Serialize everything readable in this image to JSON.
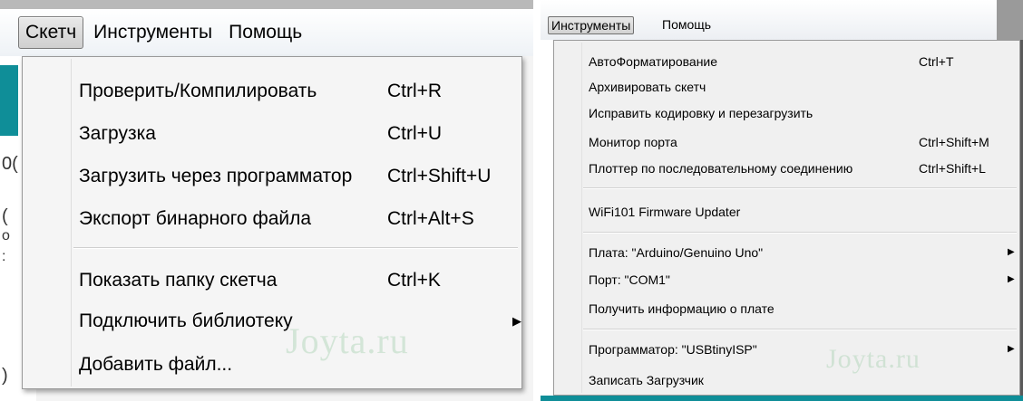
{
  "left": {
    "menubar": {
      "active": "Скетч",
      "items": [
        "Инструменты",
        "Помощь"
      ]
    },
    "menu": {
      "items": [
        {
          "label": "Проверить/Компилировать",
          "shortcut": "Ctrl+R"
        },
        {
          "label": "Загрузка",
          "shortcut": "Ctrl+U"
        },
        {
          "label": "Загрузить через программатор",
          "shortcut": "Ctrl+Shift+U"
        },
        {
          "label": "Экспорт бинарного файла",
          "shortcut": "Ctrl+Alt+S"
        },
        {
          "label": "Показать папку скетча",
          "shortcut": "Ctrl+K"
        },
        {
          "label": "Подключить библиотеку"
        },
        {
          "label": "Добавить файл..."
        }
      ]
    },
    "watermark": "Joyta.ru"
  },
  "right": {
    "menubar": {
      "active": "Инструменты",
      "items": [
        "Помощь"
      ]
    },
    "menu": {
      "items": [
        {
          "label": "АвтоФорматирование",
          "shortcut": "Ctrl+T"
        },
        {
          "label": "Архивировать скетч"
        },
        {
          "label": "Исправить кодировку и перезагрузить"
        },
        {
          "label": "Монитор порта",
          "shortcut": "Ctrl+Shift+M"
        },
        {
          "label": "Плоттер по последовательному соединению",
          "shortcut": "Ctrl+Shift+L"
        },
        {
          "label": "WiFi101 Firmware Updater"
        },
        {
          "label": "Плата: \"Arduino/Genuino Uno\""
        },
        {
          "label": "Порт: \"COM1\""
        },
        {
          "label": "Получить информацию о плате"
        },
        {
          "label": "Программатор: \"USBtinyISP\""
        },
        {
          "label": "Записать Загрузчик"
        }
      ]
    },
    "watermark": "Joyta.ru"
  },
  "icons": {
    "submenu_arrow": "▶"
  },
  "colors": {
    "accent_teal": "#0f8e98"
  }
}
